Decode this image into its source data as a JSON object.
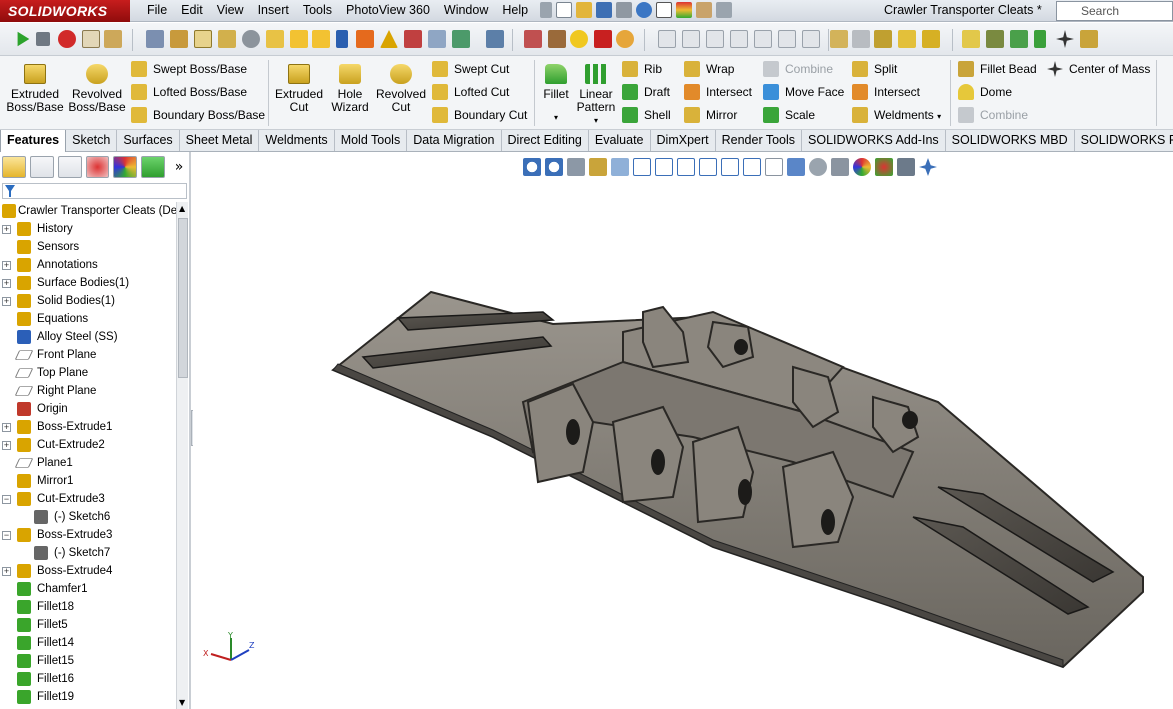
{
  "app": {
    "logo": "SOLIDWORKS",
    "doc_title": "Crawler Transporter Cleats *",
    "search_placeholder": "Search Commands"
  },
  "menu": [
    "File",
    "Edit",
    "View",
    "Insert",
    "Tools",
    "PhotoView 360",
    "Window",
    "Help"
  ],
  "ribbon": {
    "extruded_boss": "Extruded Boss/Base",
    "revolved_boss": "Revolved Boss/Base",
    "swept_boss": "Swept Boss/Base",
    "lofted_boss": "Lofted Boss/Base",
    "boundary_boss": "Boundary Boss/Base",
    "extruded_cut": "Extruded Cut",
    "hole_wizard": "Hole Wizard",
    "revolved_cut": "Revolved Cut",
    "swept_cut": "Swept Cut",
    "lofted_cut": "Lofted Cut",
    "boundary_cut": "Boundary Cut",
    "fillet": "Fillet",
    "linear_pattern": "Linear Pattern",
    "rib": "Rib",
    "draft": "Draft",
    "shell": "Shell",
    "wrap": "Wrap",
    "intersect": "Intersect",
    "mirror": "Mirror",
    "combine": "Combine",
    "move_face": "Move Face",
    "scale": "Scale",
    "split": "Split",
    "intersect2": "Intersect",
    "weldments": "Weldments",
    "fillet_bead": "Fillet Bead",
    "dome": "Dome",
    "combine2": "Combine",
    "center_of_mass": "Center of Mass"
  },
  "tabs": [
    "Features",
    "Sketch",
    "Surfaces",
    "Sheet Metal",
    "Weldments",
    "Mold Tools",
    "Data Migration",
    "Direct Editing",
    "Evaluate",
    "DimXpert",
    "Render Tools",
    "SOLIDWORKS Add-Ins",
    "SOLIDWORKS MBD",
    "SOLIDWORKS Plastics"
  ],
  "tree": {
    "root": "Crawler Transporter Cleats  (Def",
    "items": [
      {
        "label": "History",
        "expand": "+",
        "color": "#d9a400"
      },
      {
        "label": "Sensors",
        "expand": "",
        "color": "#d9a400"
      },
      {
        "label": "Annotations",
        "expand": "+",
        "color": "#d9a400"
      },
      {
        "label": "Surface Bodies(1)",
        "expand": "+",
        "color": "#d9a400"
      },
      {
        "label": "Solid Bodies(1)",
        "expand": "+",
        "color": "#d9a400"
      },
      {
        "label": "Equations",
        "expand": "",
        "color": "#d9a400"
      },
      {
        "label": "Alloy Steel (SS)",
        "expand": "",
        "color": "#2b5fb8"
      },
      {
        "label": "Front Plane",
        "expand": "",
        "color": "#777777"
      },
      {
        "label": "Top Plane",
        "expand": "",
        "color": "#777777"
      },
      {
        "label": "Right Plane",
        "expand": "",
        "color": "#777777"
      },
      {
        "label": "Origin",
        "expand": "",
        "color": "#c0392b"
      },
      {
        "label": "Boss-Extrude1",
        "expand": "+",
        "color": "#d9a400"
      },
      {
        "label": "Cut-Extrude2",
        "expand": "+",
        "color": "#d9a400"
      },
      {
        "label": "Plane1",
        "expand": "",
        "color": "#777777"
      },
      {
        "label": "Mirror1",
        "expand": "",
        "color": "#d9a400"
      },
      {
        "label": "Cut-Extrude3",
        "expand": "−",
        "color": "#d9a400"
      },
      {
        "label": "(-) Sketch6",
        "expand": "",
        "color": "#666666",
        "child": true
      },
      {
        "label": "Boss-Extrude3",
        "expand": "−",
        "color": "#d9a400"
      },
      {
        "label": "(-) Sketch7",
        "expand": "",
        "color": "#666666",
        "child": true
      },
      {
        "label": "Boss-Extrude4",
        "expand": "+",
        "color": "#d9a400"
      },
      {
        "label": "Chamfer1",
        "expand": "",
        "color": "#3aa52b"
      },
      {
        "label": "Fillet18",
        "expand": "",
        "color": "#3aa52b"
      },
      {
        "label": "Fillet5",
        "expand": "",
        "color": "#3aa52b"
      },
      {
        "label": "Fillet14",
        "expand": "",
        "color": "#3aa52b"
      },
      {
        "label": "Fillet15",
        "expand": "",
        "color": "#3aa52b"
      },
      {
        "label": "Fillet16",
        "expand": "",
        "color": "#3aa52b"
      },
      {
        "label": "Fillet19",
        "expand": "",
        "color": "#3aa52b"
      }
    ]
  },
  "triad": {
    "x": "X",
    "y": "Y",
    "z": "Z"
  }
}
